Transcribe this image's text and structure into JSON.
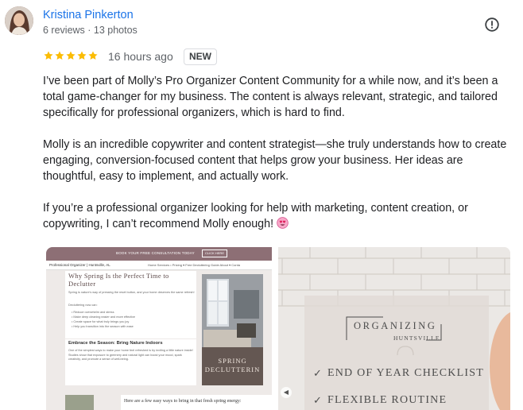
{
  "reviewer": {
    "name": "Kristina Pinkerton",
    "meta": "6 reviews · 13 photos"
  },
  "review": {
    "rating": 5,
    "time": "16 hours ago",
    "badge": "NEW",
    "paragraphs": [
      "I’ve been part of Molly’s Pro Organizer Content Community for a while now, and it’s been a total game-changer for my business. The content is always relevant, strategic, and tailored specifically for professional organizers, which is hard to find.",
      "Molly is an incredible copywriter and content strategist—she truly understands how to create engaging, conversion-focused content that helps grow your business. Her ideas are thoughtful, easy to implement, and actually work.",
      "If you’re a professional organizer looking for help with marketing, content creation, or copywriting, I can’t recommend Molly enough!"
    ]
  },
  "icons": {
    "star": "star-icon",
    "report": "report-icon",
    "emoji": "heart-eyes-emoji"
  },
  "colors": {
    "name": "#1a73e8",
    "star": "#fbbc04",
    "meta": "#5f6368",
    "banner": "#8d6f75"
  },
  "photo1": {
    "banner_cta": "BOOK YOUR FREE CONSULTATION TODAY",
    "banner_button": "CLICK HERE",
    "brand": "Professional Organizer | Huntsville, AL",
    "nav": "Home   Services • Pricing ▾   Free Decluttering Guide   About ▾   Conta",
    "heading": "Why Spring Is the Perfect Time to Declutter",
    "intro": "Spring is nature's way of pressing the reset button, and your home deserves the same refresh!",
    "subtext": "Decluttering now can:",
    "bullets": [
      "Reduce overwhelm and stress",
      "Make deep cleaning easier and more effective",
      "Create space for what truly brings you joy",
      "Help you transition into the season with ease"
    ],
    "section_title": "Embrace the Season: Bring Nature Indoors",
    "section_body": "One of the simplest ways to make your home feel refreshed is by inviting a little nature inside! Studies show that exposure to greenery and natural light can boost your mood, spark creativity, and promote a sense of well-being.",
    "bottom_text": "Here are a few easy ways to bring in that fresh spring energy:",
    "image_caption_1": "SPRING",
    "image_caption_2": "DECLUTTERIN"
  },
  "photo2": {
    "brand_line1": "ORGANIZING",
    "brand_line2": "HUNTSVILLE",
    "items": [
      "END OF YEAR CHECKLIST",
      "FLEXIBLE ROUTINE"
    ]
  }
}
